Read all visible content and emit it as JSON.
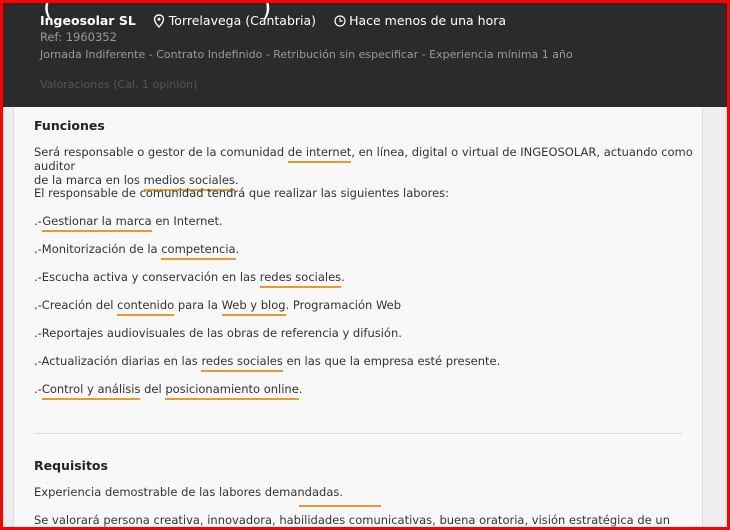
{
  "header": {
    "company": "Ingeosolar SL",
    "location": "Torrelavega (Cantabria)",
    "posted": "Hace menos de una hora",
    "ref": "Ref: 1960352",
    "details": "Jornada Indiferente - Contrato Indefinido - Retribución sin especificar - Experiencia mínima 1 año",
    "faded_text": "Valoraciones (Cal. 1 opinión)"
  },
  "funciones": {
    "title": "Funciones",
    "intro_line1_pre": "Será responsable o gestor de la comunidad ",
    "intro_link1": "de internet",
    "intro_line1_post": ", en línea, digital o virtual de INGEOSOLAR,  actuando como auditor",
    "intro_line2_pre": "de la marca en los ",
    "intro_link2": "medios sociales",
    "intro_line2_post": ".",
    "labores": "El responsable de comunidad tendrá que realizar las siguientes labores:",
    "items": [
      {
        "pre": ".-",
        "link": "Gestionar la marca",
        "post": " en Internet."
      },
      {
        "pre": ".-Monitorización de la ",
        "link": "competencia",
        "post": "."
      },
      {
        "pre": ".-Escucha activa y conservación en las ",
        "link": "redes sociales",
        "post": "."
      },
      {
        "pre": ".-Creación del ",
        "link": "contenido",
        "mid": " para la ",
        "link2": "Web y blog",
        "post": ". Programación Web"
      },
      {
        "pre": ".-Reportajes audiovisuales de las obras de referencia y difusión.",
        "link": "",
        "post": ""
      },
      {
        "pre": ".-Actualización diarias en las ",
        "link": "redes sociales",
        "post": " en las que la empresa esté presente."
      },
      {
        "pre": ".-",
        "link": "Control y análisis",
        "mid": " del ",
        "link2": "posicionamiento online",
        "post": "."
      }
    ]
  },
  "requisitos": {
    "title": "Requisitos",
    "line1": "Experiencia demostrable de las labores demandadas.",
    "line2": "Se valorará persona creativa, innovadora, habilidades comunicativas, buena oratoria, visión estratégica de un mundo"
  }
}
